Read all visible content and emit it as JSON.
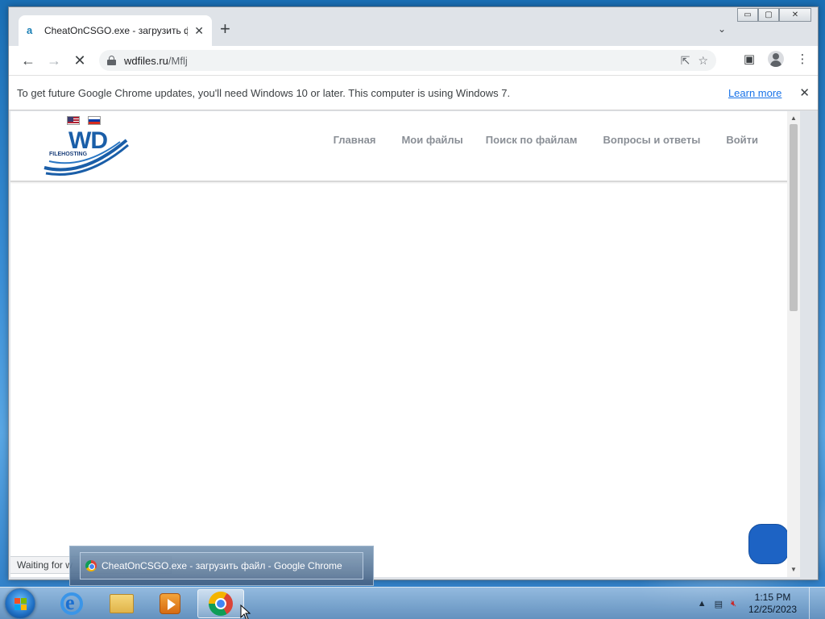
{
  "browser": {
    "tab": {
      "title": "CheatOnCSGO.exe - загрузить ф",
      "favicon": "a"
    },
    "window_controls": {
      "minimize": "▭",
      "maximize": "▢",
      "close": "✕"
    },
    "address": {
      "host": "wdfiles.ru",
      "path": "/Mflj"
    },
    "infobar": {
      "message": "To get future Google Chrome updates, you'll need Windows 10 or later. This computer is using Windows 7.",
      "learn_more": "Learn more"
    },
    "status_text": "Waiting for w"
  },
  "site": {
    "logo_text": "WD",
    "logo_subtext": "FILEHOSTING",
    "flags": [
      "us-flag",
      "ru-flag"
    ],
    "nav": [
      {
        "label": "Главная",
        "caret": ""
      },
      {
        "label": "Мои файлы",
        "caret": ""
      },
      {
        "label": "Поиск по файлам",
        "caret": ""
      },
      {
        "label": "Вопросы и ответы",
        "caret": ""
      },
      {
        "label": "Войти",
        "prefix": ""
      }
    ]
  },
  "taskbar": {
    "tooltip": "CheatOnCSGO.exe - загрузить файл - Google Chrome",
    "apps": [
      "internet-explorer-icon",
      "windows-explorer-icon",
      "media-player-icon",
      "chrome-icon"
    ],
    "clock_time": "1:15 PM",
    "clock_date": "12/25/2023"
  },
  "colors": {
    "accent": "#1a73e8",
    "chat_button": "#1d63c4",
    "logo_blue": "#1a5ea8"
  }
}
